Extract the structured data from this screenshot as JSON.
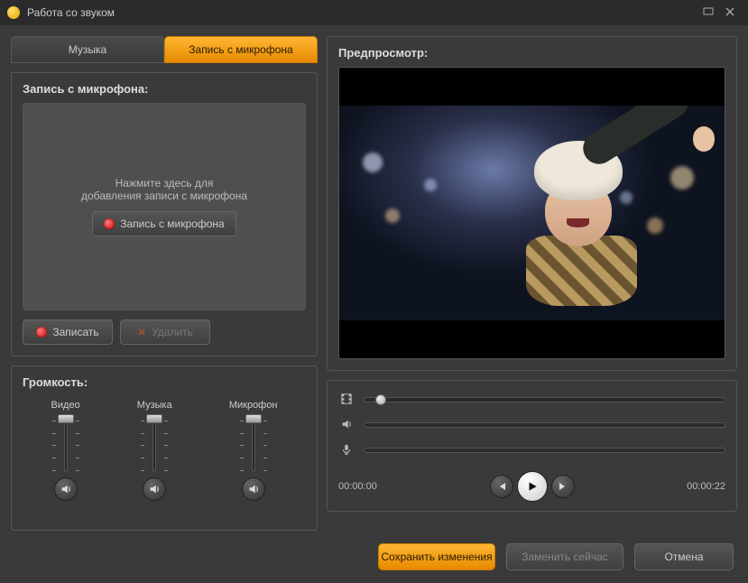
{
  "window": {
    "title": "Работа со звуком"
  },
  "tabs": {
    "music": "Музыка",
    "mic": "Запись с микрофона",
    "active": "mic"
  },
  "mic_panel": {
    "title": "Запись с микрофона:",
    "hint_line1": "Нажмите здесь для",
    "hint_line2": "добавления записи с микрофона",
    "record_btn": "Запись с микрофона",
    "record_btn2": "Записать",
    "delete_btn": "Удалить"
  },
  "volume": {
    "title": "Громкость:",
    "video": "Видео",
    "music": "Музыка",
    "mic": "Микрофон"
  },
  "preview": {
    "title": "Предпросмотр:"
  },
  "transport": {
    "current": "00:00:00",
    "total": "00:00:22"
  },
  "footer": {
    "save": "Сохранить изменения",
    "replace": "Заменить сейчас",
    "cancel": "Отмена"
  }
}
